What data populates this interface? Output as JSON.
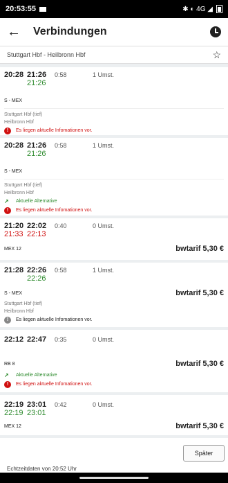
{
  "status": {
    "time": "20:53:55",
    "right": "✱ ◐ 4G ◢"
  },
  "app": {
    "title": "Verbindungen"
  },
  "route": "Stuttgart Hbf - Heilbronn Hbf",
  "connections": [
    {
      "dep": "20:28",
      "arr": "21:26",
      "dur": "0:58",
      "changes": "1 Umst.",
      "rt_dep": "",
      "rt_arr": "21:26",
      "train": "S - MEX",
      "price": "",
      "stops": [
        "Stuttgart Hbf (tief)",
        "Heilbronn Hbf"
      ],
      "alt": "",
      "info": "Es liegen aktuelle Infomationen vor."
    },
    {
      "dep": "20:28",
      "arr": "21:26",
      "dur": "0:58",
      "changes": "1 Umst.",
      "rt_dep": "",
      "rt_arr": "21:26",
      "train": "S - MEX",
      "price": "",
      "stops": [
        "Stuttgart Hbf (tief)",
        "Heilbronn Hbf"
      ],
      "alt": "Aktuelle Alternative",
      "info": "Es liegen aktuelle Infomationen vor."
    },
    {
      "dep": "21:20",
      "arr": "22:02",
      "dur": "0:40",
      "changes": "0 Umst.",
      "rt_dep": "21:33",
      "rt_arr": "22:13",
      "train": "MEX 12",
      "price": "bwtarif 5,30 €",
      "stops": [],
      "alt": "",
      "info": ""
    },
    {
      "dep": "21:28",
      "arr": "22:26",
      "dur": "0:58",
      "changes": "1 Umst.",
      "rt_dep": "",
      "rt_arr": "22:26",
      "train": "S - MEX",
      "price": "bwtarif 5,30 €",
      "stops": [
        "Stuttgart Hbf (tief)",
        "Heilbronn Hbf"
      ],
      "alt": "",
      "info": "Es liegen aktuelle Infomationen vor."
    },
    {
      "dep": "22:12",
      "arr": "22:47",
      "dur": "0:35",
      "changes": "0 Umst.",
      "rt_dep": "",
      "rt_arr": "",
      "train": "RB 8",
      "price": "bwtarif 5,30 €",
      "stops": [],
      "alt": "Aktuelle Alternative",
      "info": "Es liegen aktuelle Infomationen vor."
    },
    {
      "dep": "22:19",
      "arr": "23:01",
      "dur": "0:42",
      "changes": "0 Umst.",
      "rt_dep": "22:19",
      "rt_arr": "23:01",
      "train": "MEX 12",
      "price": "bwtarif 5,30 €",
      "stops": [],
      "alt": "",
      "info": ""
    }
  ],
  "footer": {
    "later": "Später",
    "realtime": "Echtzeitdaten von 20:52 Uhr"
  }
}
